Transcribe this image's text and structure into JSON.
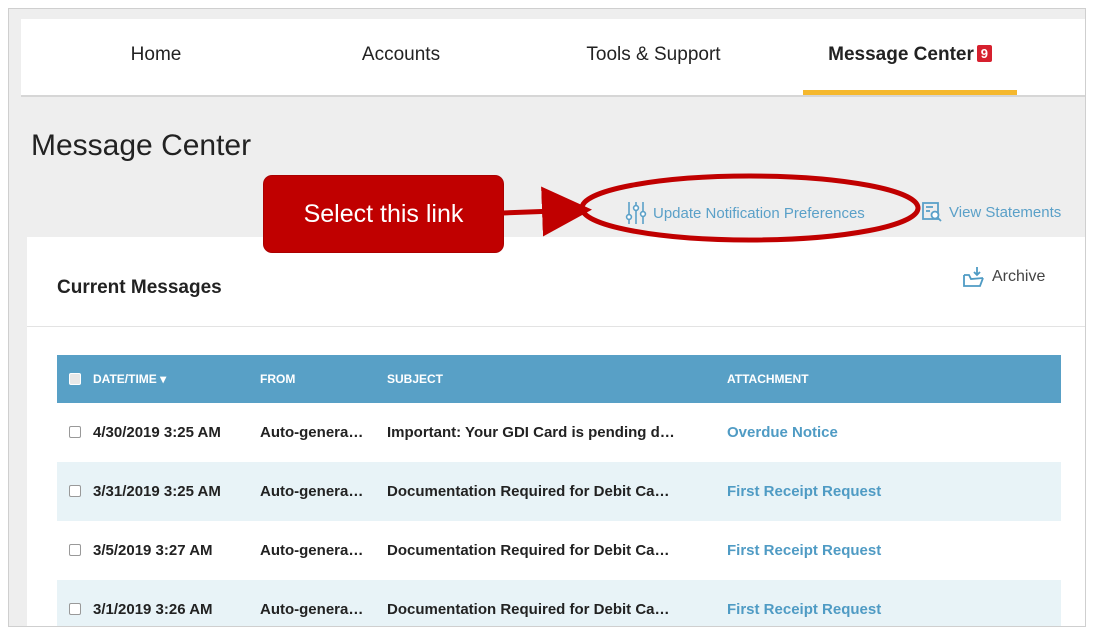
{
  "nav": {
    "items": [
      {
        "label": "Home"
      },
      {
        "label": "Accounts"
      },
      {
        "label": "Tools & Support"
      },
      {
        "label": "Message Center",
        "badge": "9"
      }
    ]
  },
  "page": {
    "title": "Message Center",
    "links": {
      "update_prefs": "Update Notification Preferences",
      "view_statements": "View Statements"
    }
  },
  "panel": {
    "title": "Current Messages",
    "archive": "Archive"
  },
  "table": {
    "headers": [
      "DATE/TIME",
      "FROM",
      "SUBJECT",
      "ATTACHMENT"
    ],
    "rows": [
      {
        "date": "4/30/2019 3:25 AM",
        "from": "Auto-genera…",
        "subject": "Important: Your GDI Card is pending d…",
        "attachment": "Overdue Notice"
      },
      {
        "date": "3/31/2019 3:25 AM",
        "from": "Auto-genera…",
        "subject": "Documentation Required for Debit Ca…",
        "attachment": "First Receipt Request"
      },
      {
        "date": "3/5/2019 3:27 AM",
        "from": "Auto-genera…",
        "subject": "Documentation Required for Debit Ca…",
        "attachment": "First Receipt Request"
      },
      {
        "date": "3/1/2019 3:26 AM",
        "from": "Auto-genera…",
        "subject": "Documentation Required for Debit Ca…",
        "attachment": "First Receipt Request"
      }
    ]
  },
  "annotation": {
    "callout": "Select this link"
  },
  "colors": {
    "accent_underline": "#f5b82e",
    "badge": "#d6202e",
    "table_header": "#58a0c6",
    "link": "#5aa0c8",
    "callout": "#c00000"
  }
}
